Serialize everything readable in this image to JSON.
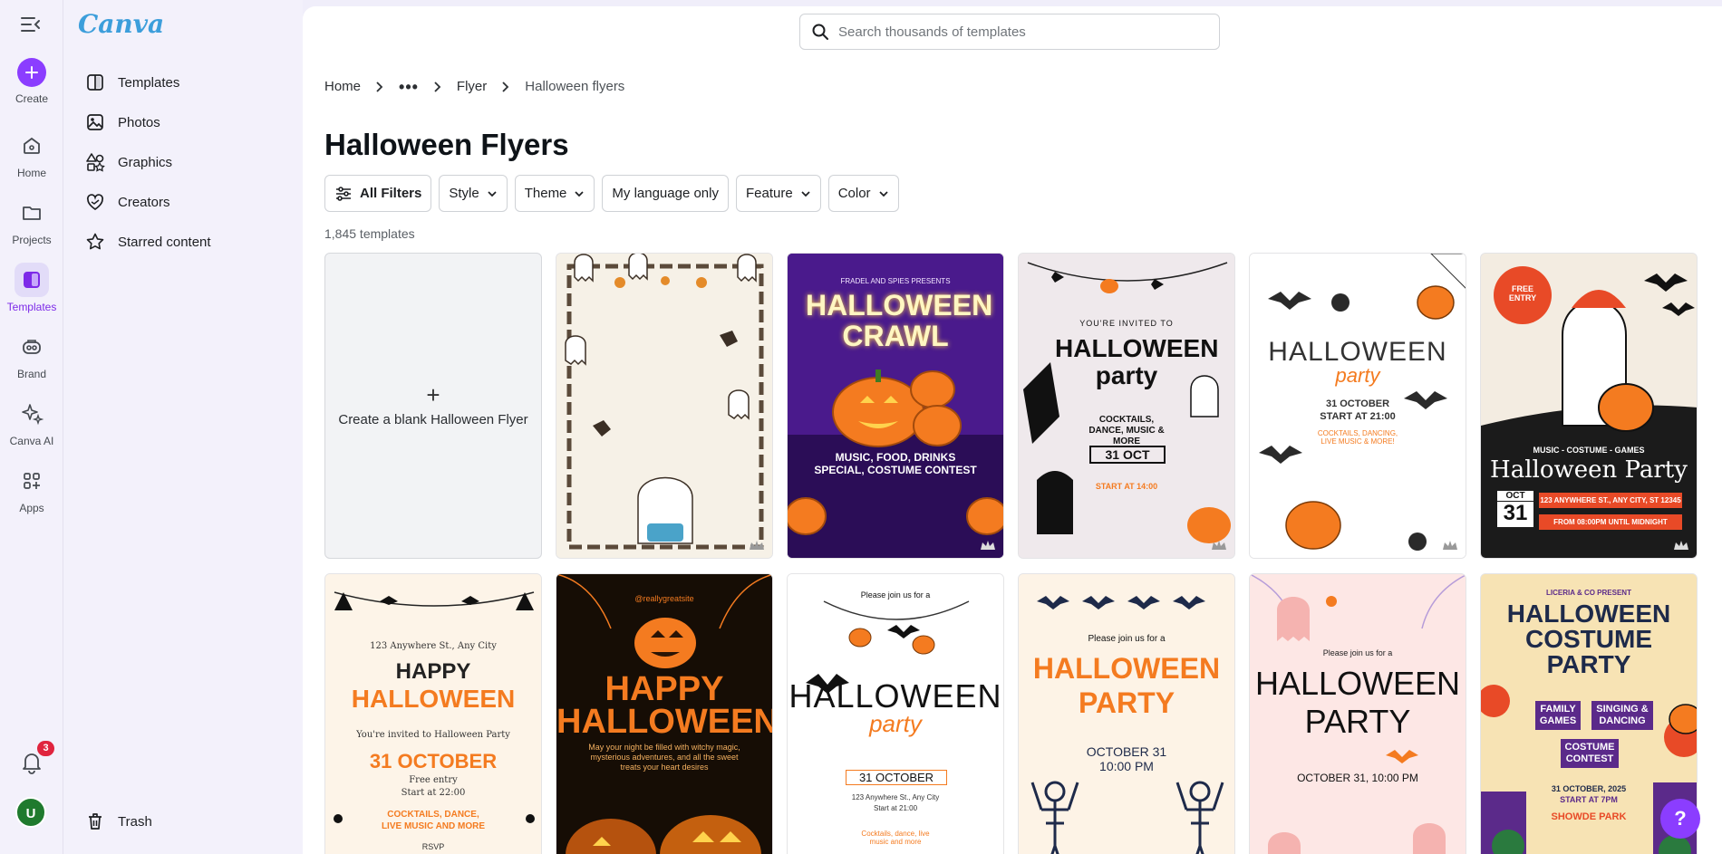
{
  "app": {
    "logo": "Canva"
  },
  "rail": {
    "items": [
      {
        "label": "Create"
      },
      {
        "label": "Home"
      },
      {
        "label": "Projects"
      },
      {
        "label": "Templates"
      },
      {
        "label": "Brand"
      },
      {
        "label": "Canva AI"
      },
      {
        "label": "Apps"
      }
    ],
    "notifications_count": "3",
    "avatar_initial": "U"
  },
  "sidebar": {
    "items": [
      {
        "label": "Templates"
      },
      {
        "label": "Photos"
      },
      {
        "label": "Graphics"
      },
      {
        "label": "Creators"
      },
      {
        "label": "Starred content"
      }
    ],
    "trash": "Trash"
  },
  "search": {
    "placeholder": "Search thousands of templates"
  },
  "breadcrumb": {
    "home": "Home",
    "more": "•••",
    "flyer": "Flyer",
    "current": "Halloween flyers"
  },
  "page_title": "Halloween Flyers",
  "filters": {
    "all": "All Filters",
    "style": "Style",
    "theme": "Theme",
    "language": "My language only",
    "feature": "Feature",
    "color": "Color"
  },
  "template_count": "1,845 templates",
  "blank_card": {
    "label": "Create a blank Halloween Flyer"
  },
  "templates": [
    {
      "lines": [
        "",
        "",
        ""
      ]
    },
    {
      "lines": [
        "FRADEL AND SPIES PRESENTS",
        "HALLOWEEN CRAWL",
        "MUSIC, FOOD, DRINKS SPECIAL, COSTUME CONTEST"
      ]
    },
    {
      "lines": [
        "YOU'RE INVITED TO",
        "HALLOWEEN party",
        "COCKTAILS, DANCE, MUSIC & MORE",
        "31 OCT",
        "START AT 14:00"
      ]
    },
    {
      "lines": [
        "HALLOWEEN",
        "party",
        "31 OCTOBER",
        "START AT 21:00",
        "COCKTAILS, DANCING, LIVE MUSIC & MORE!"
      ]
    },
    {
      "lines": [
        "FREE ENTRY",
        "MUSIC - COSTUME - GAMES",
        "Halloween Party",
        "OCT",
        "31",
        "123 ANYWHERE ST., ANY CITY, ST 12345",
        "FROM 08:00PM UNTIL MIDNIGHT"
      ]
    },
    {
      "lines": [
        "123 Anywhere St., Any City",
        "HAPPY",
        "HALLOWEEN",
        "You're invited to Halloween Party",
        "31 OCTOBER",
        "Free entry",
        "Start at 22:00",
        "COCKTAILS, DANCE,",
        "LIVE MUSIC AND MORE",
        "RSVP"
      ]
    },
    {
      "lines": [
        "@reallygreatsite",
        "HAPPY",
        "HALLOWEEN",
        "May your night be filled with witchy magic, mysterious adventures, and all the sweet treats your heart desires"
      ]
    },
    {
      "lines": [
        "Please join us for a",
        "HALLOWEEN",
        "party",
        "31 OCTOBER",
        "123 Anywhere St., Any City",
        "Start at 21:00",
        "Cocktails, dance, live music and more"
      ]
    },
    {
      "lines": [
        "Please join us for a",
        "HALLOWEEN",
        "PARTY",
        "OCTOBER 31",
        "10:00 PM"
      ]
    },
    {
      "lines": [
        "Please join us for a",
        "HALLOWEEN",
        "PARTY",
        "OCTOBER 31, 10:00 PM"
      ]
    },
    {
      "lines": [
        "LICERIA & CO PRESENT",
        "HALLOWEEN",
        "COSTUME",
        "PARTY",
        "FAMILY GAMES",
        "SINGING & DANCING",
        "COSTUME CONTEST",
        "31 OCTOBER, 2025",
        "START AT 7PM",
        "SHOWDE PARK"
      ]
    }
  ],
  "help_label": "?",
  "colors": {
    "accent": "#8b3dff",
    "orange": "#f47b20",
    "purple_dark": "#3a1476"
  }
}
